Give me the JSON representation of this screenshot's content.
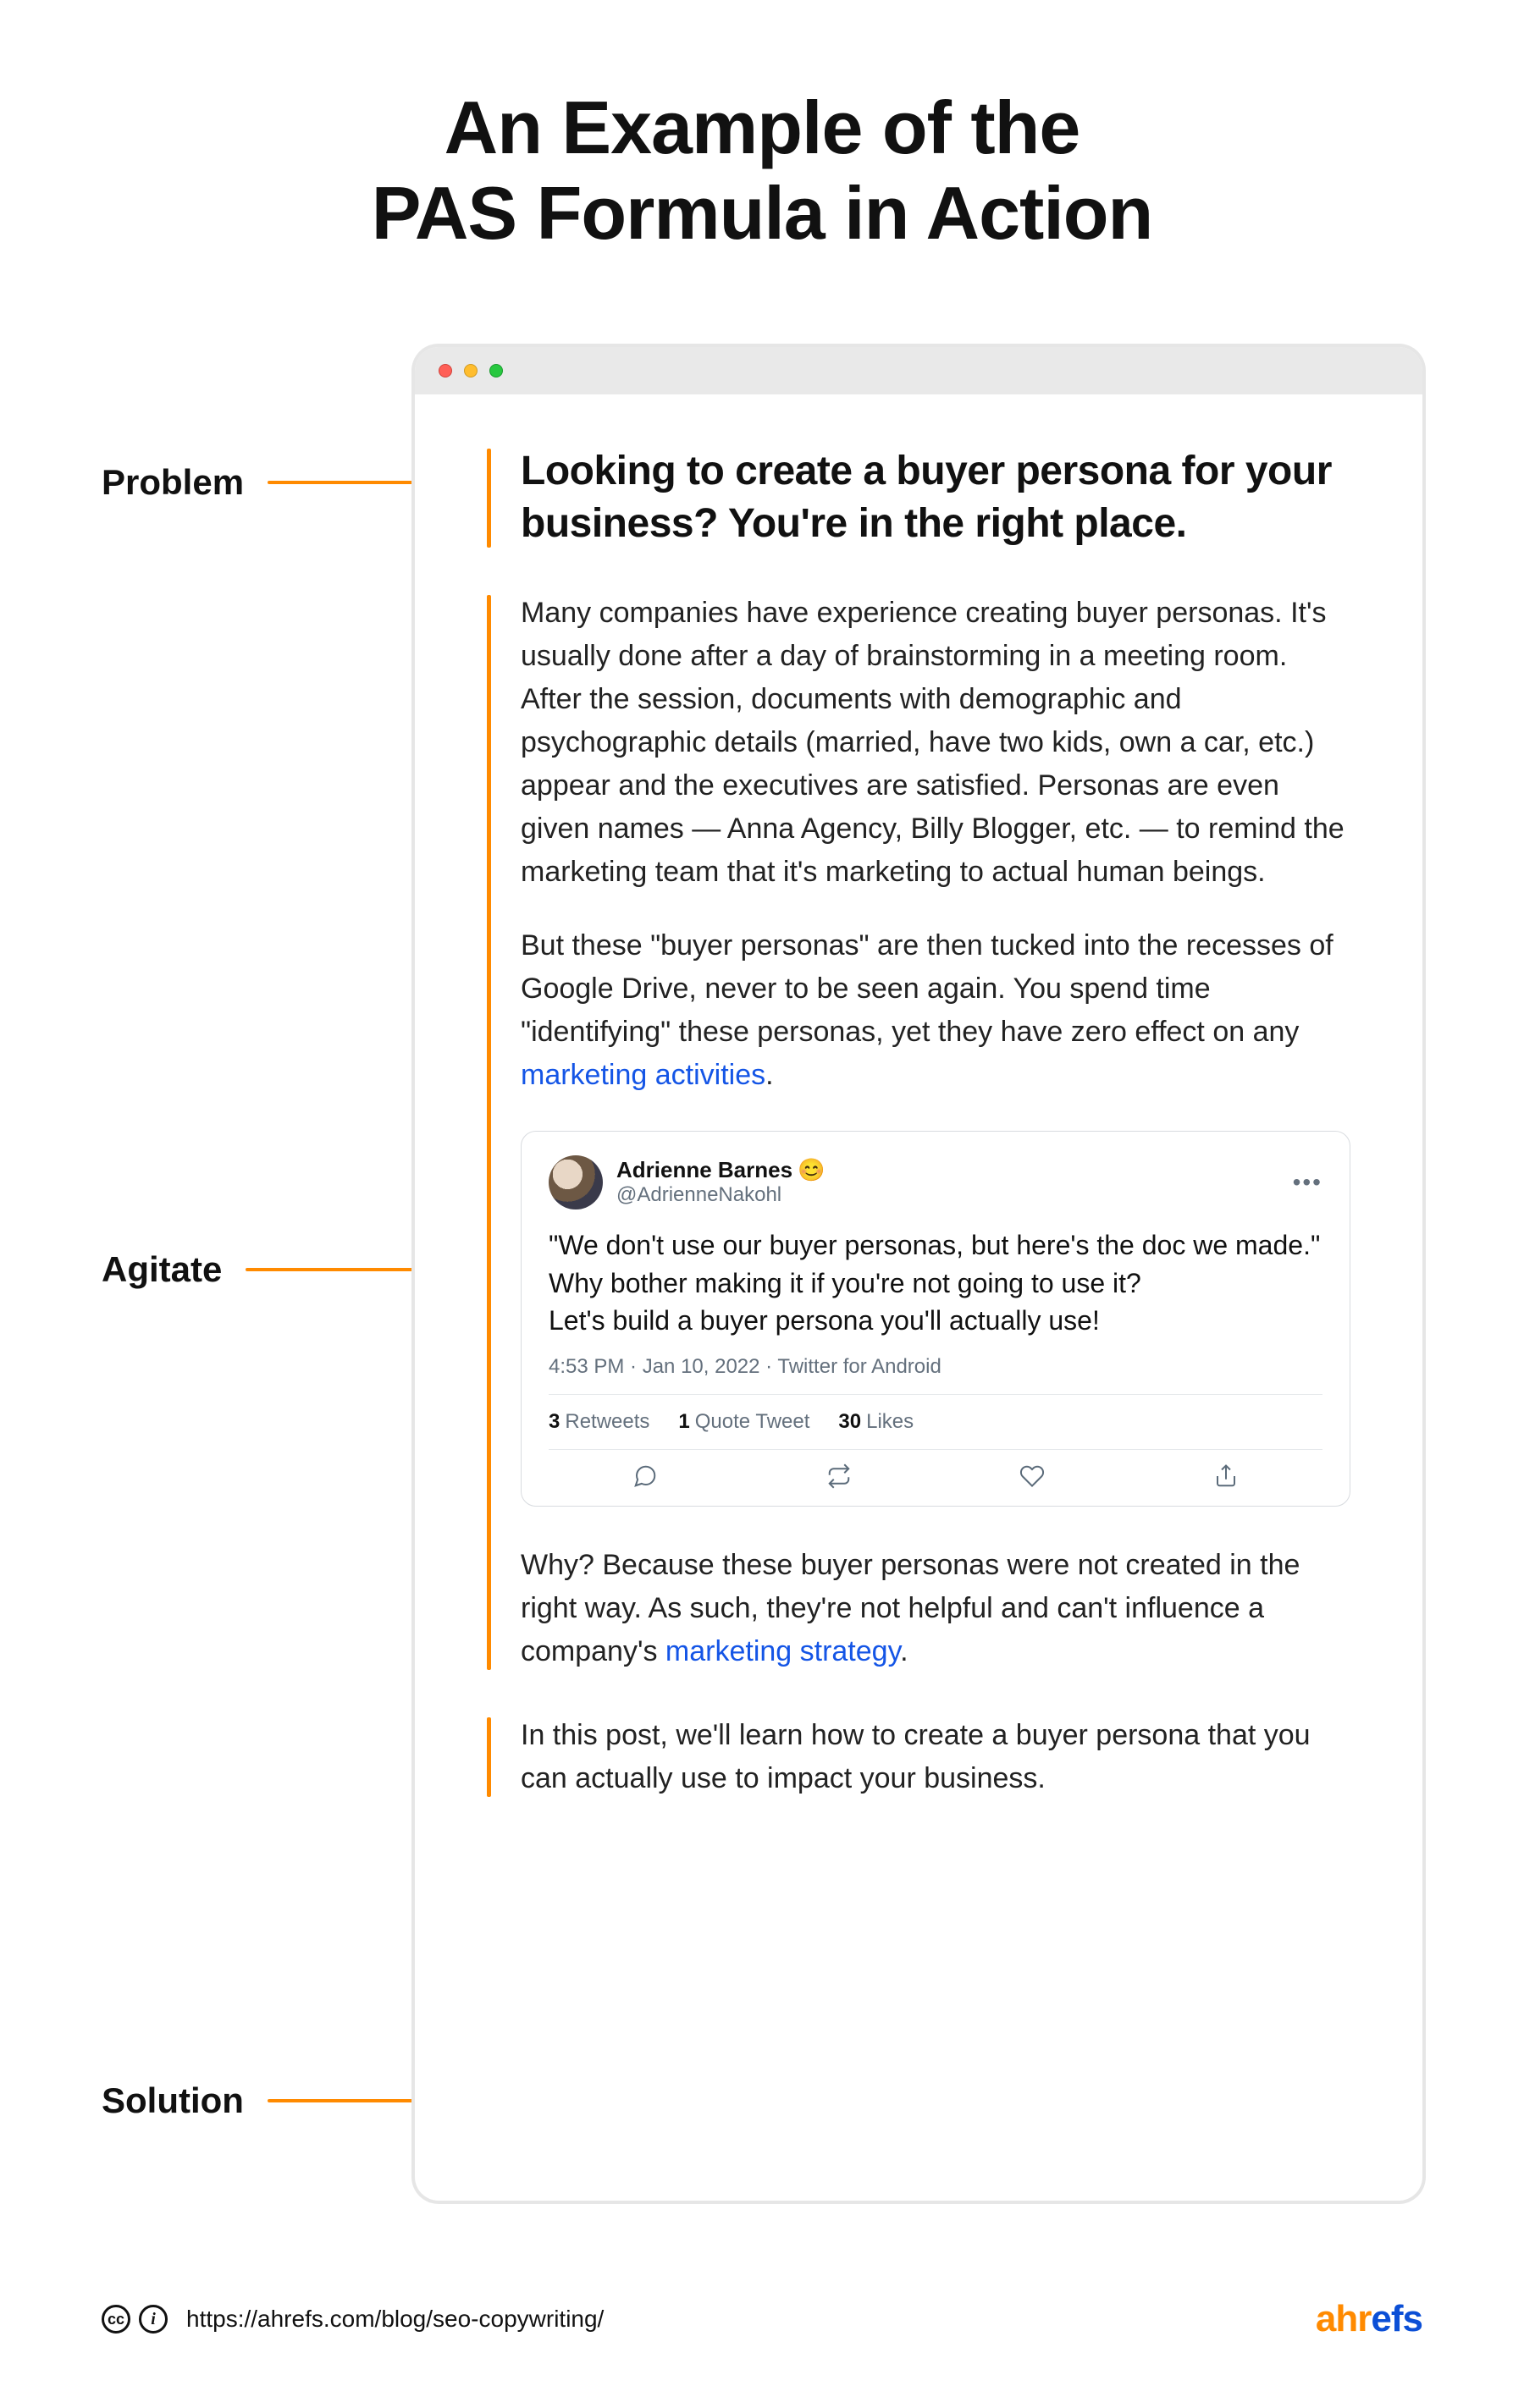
{
  "title": "An Example of the\nPAS Formula in Action",
  "annotations": {
    "problem": "Problem",
    "agitate": "Agitate",
    "solution": "Solution"
  },
  "sections": {
    "problem": {
      "headline": "Looking to create a buyer persona for your business? You're in the right place."
    },
    "agitate": {
      "para1": "Many companies have experience creating buyer personas. It's usually done after a day of brainstorming in a meeting room. After the session, documents with demographic and psychographic details (married, have two kids, own a car, etc.) appear and the executives are satisfied. Personas are even given names — Anna Agency, Billy Blogger, etc. — to remind the marketing team that it's marketing to actual human beings.",
      "para2_pre": "But these \"buyer personas\" are then tucked into the recesses of Google Drive, never to be seen again. You spend time \"identifying\" these personas, yet they have zero effect on any ",
      "para2_link": "marketing activities",
      "para2_post": ".",
      "para3_pre": "Why? Because these buyer personas were not created in the right way. As such, they're not helpful and can't influence a company's ",
      "para3_link": "marketing strategy",
      "para3_post": "."
    },
    "solution": {
      "para": "In this post, we'll learn how to create a buyer persona that you can actually use to impact your business."
    }
  },
  "tweet": {
    "name": "Adrienne Barnes",
    "emoji": "😊",
    "handle": "@AdrienneNakohl",
    "body_line1": "\"We don't use our buyer personas, but here's the doc we made.\"",
    "body_line2": "Why bother making it if you're not going to use it?",
    "body_line3": "Let's build a buyer persona you'll actually use!",
    "meta": "4:53 PM · Jan 10, 2022 · Twitter for Android",
    "stats": {
      "retweets_count": "3",
      "retweets_label": "Retweets",
      "quotes_count": "1",
      "quotes_label": "Quote Tweet",
      "likes_count": "30",
      "likes_label": "Likes"
    }
  },
  "footer": {
    "cc": "cc",
    "by": "i",
    "url": "https://ahrefs.com/blog/seo-copywriting/",
    "brand_left": "ahr",
    "brand_right": "efs"
  }
}
